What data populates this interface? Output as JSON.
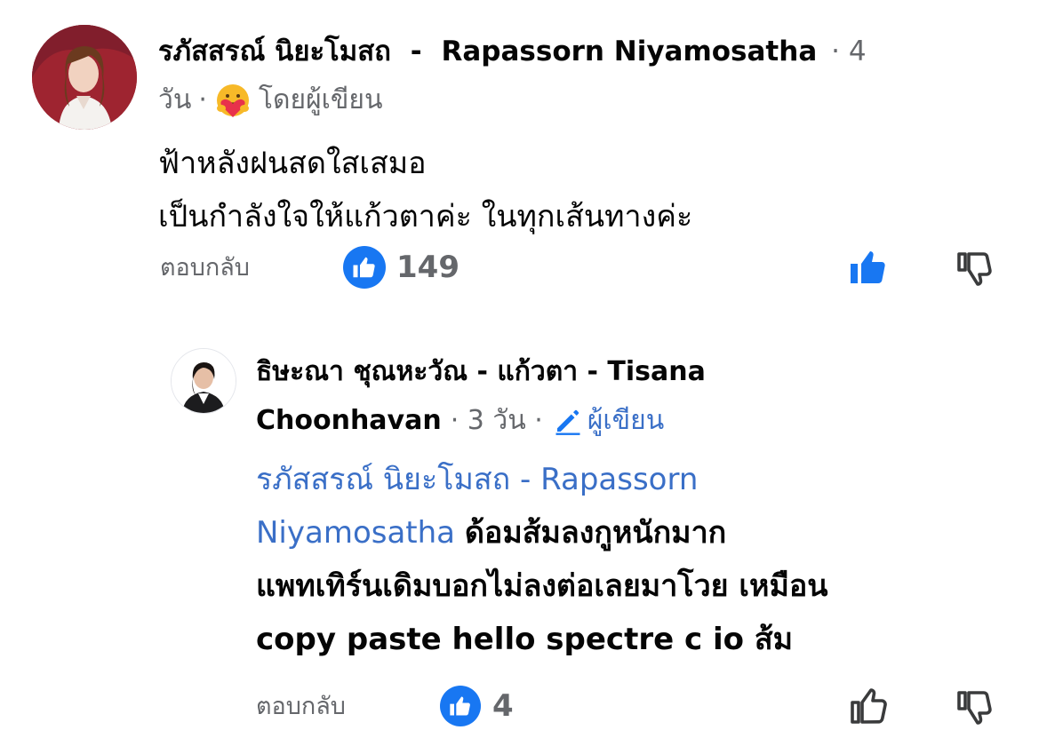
{
  "comment": {
    "author_thai": "รภัสสรณ์ นิยะโมสถ",
    "author_sep": "-",
    "author_en": "Rapassorn Niyamosatha",
    "time_dot": "·",
    "time_num": "4",
    "time_unit": "วัน",
    "time_dot2": "·",
    "author_label": "โดยผู้เขียน",
    "text_line1": "ฟ้าหลังฝนสดใสเสมอ",
    "text_line2": "เป็นกำลังใจให้แก้วตาค่ะ ในทุกเส้นทางค่ะ",
    "reply_label": "ตอบกลับ",
    "like_count": "149",
    "upvoted": true
  },
  "reply": {
    "author_line1": "ธิษะณา ชุณหะวัณ - แก้วตา - Tisana",
    "author_line2": "Choonhavan",
    "time": "· 3 วัน ·",
    "author_label": "ผู้เขียน",
    "mention_line1": "รภัสสรณ์ นิยะโมสถ  -  Rapassorn",
    "mention_line2": "Niyamosatha",
    "text_line2": "ด้อมส้มลงกูหนักมาก",
    "text_line3": "แพทเทิร์นเดิมบอกไม่ลงต่อเลยมาโวย เหมือน",
    "text_line4": "copy paste hello spectre c io ส้ม",
    "reply_label": "ตอบกลับ",
    "like_count": "4",
    "upvoted": false
  },
  "colors": {
    "accent": "#1877f2",
    "link": "#3a6fc7",
    "meta": "#65676b"
  }
}
